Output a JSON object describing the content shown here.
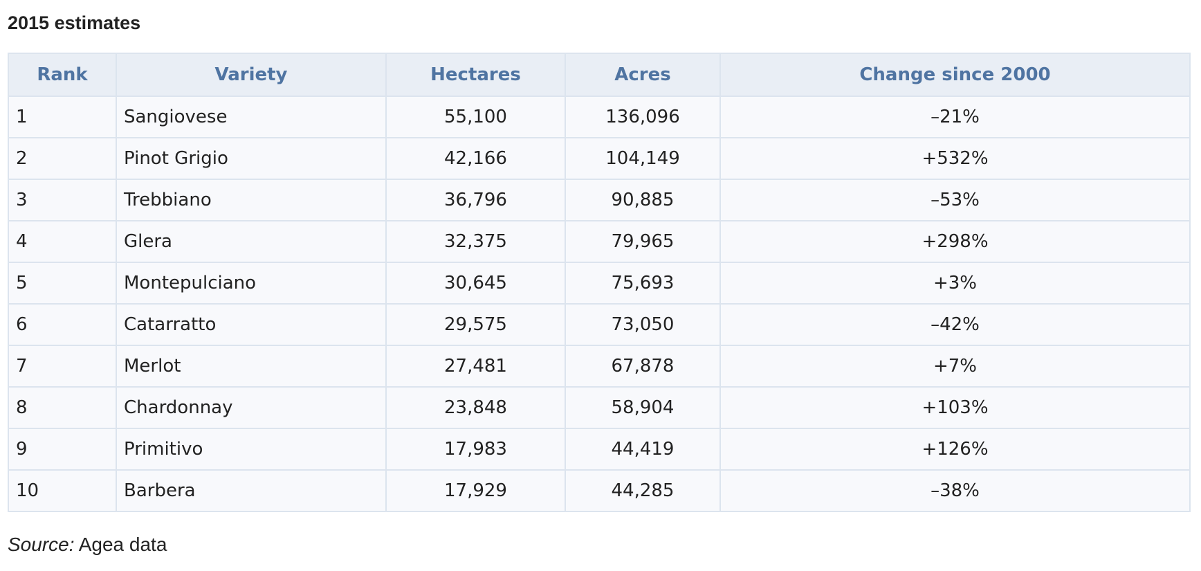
{
  "caption": "2015 estimates",
  "table": {
    "headers": [
      "Rank",
      "Variety",
      "Hectares",
      "Acres",
      "Change since 2000"
    ],
    "rows": [
      {
        "rank": "1",
        "variety": "Sangiovese",
        "hectares": "55,100",
        "acres": "136,096",
        "change": "–21%"
      },
      {
        "rank": "2",
        "variety": "Pinot Grigio",
        "hectares": "42,166",
        "acres": "104,149",
        "change": "+532%"
      },
      {
        "rank": "3",
        "variety": "Trebbiano",
        "hectares": "36,796",
        "acres": "90,885",
        "change": "–53%"
      },
      {
        "rank": "4",
        "variety": "Glera",
        "hectares": "32,375",
        "acres": "79,965",
        "change": "+298%"
      },
      {
        "rank": "5",
        "variety": "Montepulciano",
        "hectares": "30,645",
        "acres": "75,693",
        "change": "+3%"
      },
      {
        "rank": "6",
        "variety": "Catarratto",
        "hectares": "29,575",
        "acres": "73,050",
        "change": "–42%"
      },
      {
        "rank": "7",
        "variety": "Merlot",
        "hectares": "27,481",
        "acres": "67,878",
        "change": "+7%"
      },
      {
        "rank": "8",
        "variety": "Chardonnay",
        "hectares": "23,848",
        "acres": "58,904",
        "change": "+103%"
      },
      {
        "rank": "9",
        "variety": "Primitivo",
        "hectares": "17,983",
        "acres": "44,419",
        "change": "+126%"
      },
      {
        "rank": "10",
        "variety": "Barbera",
        "hectares": "17,929",
        "acres": "44,285",
        "change": "–38%"
      }
    ]
  },
  "source": {
    "label": "Source:",
    "text": "Agea data"
  },
  "colors": {
    "header_text": "#4f74a2",
    "header_bg": "#e9eef5",
    "row_bg": "#f8f9fc",
    "border": "#dce4ee"
  }
}
